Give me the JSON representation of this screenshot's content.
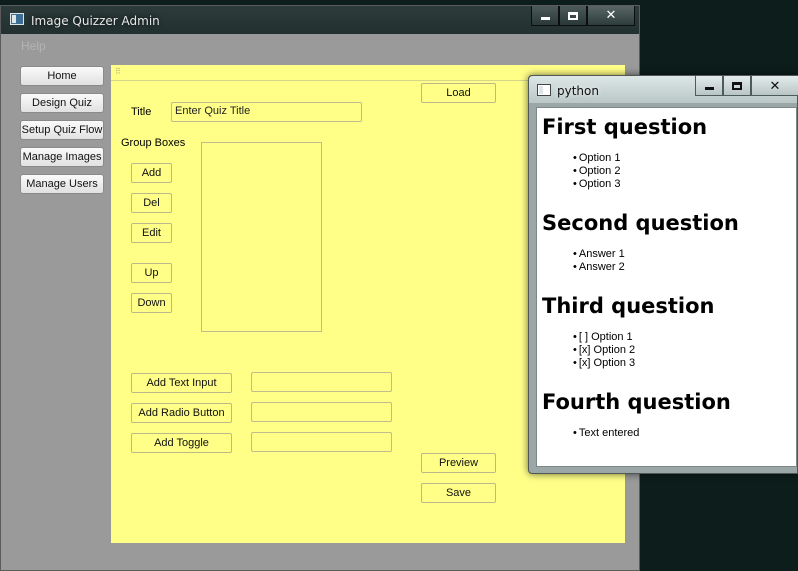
{
  "main_window": {
    "title": "Image Quizzer Admin",
    "menu_help": "Help"
  },
  "nav": {
    "home": "Home",
    "design_quiz": "Design Quiz",
    "setup_quiz_flow": "Setup Quiz Flow",
    "manage_images": "Manage Images",
    "manage_users": "Manage Users"
  },
  "editor": {
    "load": "Load",
    "title_label": "Title",
    "title_value": "Enter Quiz Title",
    "group_boxes_label": "Group Boxes",
    "add": "Add",
    "del": "Del",
    "edit": "Edit",
    "up": "Up",
    "down": "Down",
    "add_text_input": "Add Text Input",
    "add_radio_button": "Add Radio Button",
    "add_toggle": "Add Toggle",
    "text_input_value": "",
    "radio_button_value": "",
    "toggle_value": "",
    "preview": "Preview",
    "save": "Save"
  },
  "python_window": {
    "title": "python",
    "questions": [
      {
        "heading": "First question",
        "options": [
          "Option 1",
          "Option 2",
          "Option 3"
        ]
      },
      {
        "heading": "Second question",
        "options": [
          "Answer 1",
          "Answer 2"
        ]
      },
      {
        "heading": "Third question",
        "options": [
          "[ ] Option 1",
          "[x] Option 2",
          "[x] Option 3"
        ]
      },
      {
        "heading": "Fourth question",
        "options": [
          "Text entered"
        ]
      }
    ]
  }
}
